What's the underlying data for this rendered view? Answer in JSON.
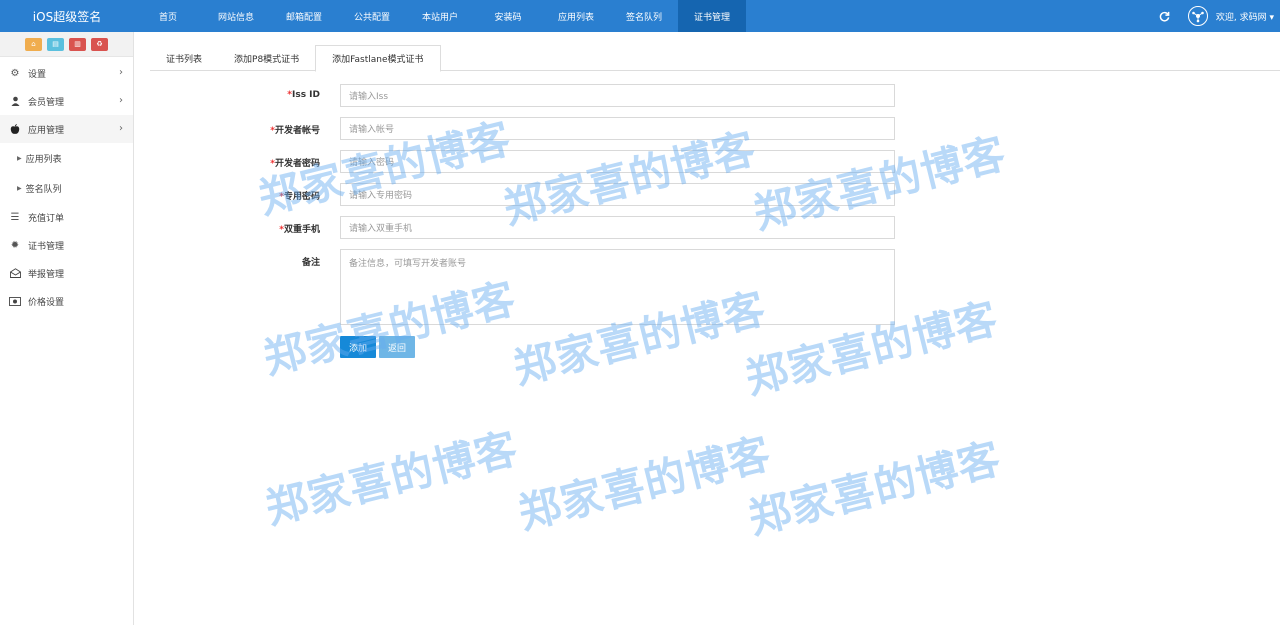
{
  "brand": "iOS超级签名",
  "nav": [
    "首页",
    "网站信息",
    "邮箱配置",
    "公共配置",
    "本站用户",
    "安装码",
    "应用列表",
    "签名队列",
    "证书管理"
  ],
  "nav_active_index": 8,
  "topright": {
    "refresh_icon": "refresh-icon",
    "user_icon": "user-circle-icon",
    "welcome": "欢迎, 求码网 ▾"
  },
  "shortcuts": [
    {
      "icon": "home-icon",
      "color": "#f0ad4e"
    },
    {
      "icon": "file-icon",
      "color": "#5bc0de"
    },
    {
      "icon": "trash-icon",
      "color": "#d9534f"
    },
    {
      "icon": "recycle-icon",
      "color": "#d9534f"
    }
  ],
  "sidebar": {
    "settings": "设置",
    "members": "会员管理",
    "apps": "应用管理",
    "app_list": "应用列表",
    "sign_queue": "签名队列",
    "recharge": "充值订单",
    "certs": "证书管理",
    "reports": "举报管理",
    "prices": "价格设置"
  },
  "tabs": [
    "证书列表",
    "添加P8模式证书",
    "添加Fastlane模式证书"
  ],
  "active_tab_index": 2,
  "form": {
    "iss_label": "Iss ID",
    "iss_placeholder": "请输入Iss",
    "account_label": "开发者帐号",
    "account_placeholder": "请输入帐号",
    "password_label": "开发者密码",
    "password_placeholder": "请输入密码",
    "app_password_label": "专用密码",
    "app_password_placeholder": "请输入专用密码",
    "phone_label": "双重手机",
    "phone_placeholder": "请输入双重手机",
    "note_label": "备注",
    "note_placeholder": "备注信息，可填写开发者账号",
    "add_button": "添加",
    "back_button": "返回"
  },
  "watermark": "郑家喜的博客"
}
